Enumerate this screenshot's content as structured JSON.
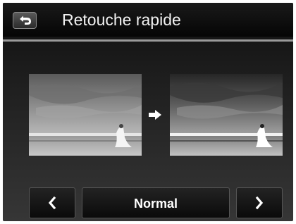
{
  "header": {
    "title": "Retouche rapide",
    "back_icon": "back-arrow-icon"
  },
  "preview": {
    "before_image": "beach-bride-photo-original",
    "after_image": "beach-bride-photo-retouched",
    "arrow_icon": "right-arrow-icon"
  },
  "controls": {
    "prev_icon": "chevron-left-icon",
    "mode_value": "Normal",
    "next_icon": "chevron-right-icon"
  },
  "colors": {
    "background": "#2b2b2b",
    "title_bar": "#0a0a0a",
    "text": "#ffffff",
    "divider": "#9a9a9a"
  }
}
